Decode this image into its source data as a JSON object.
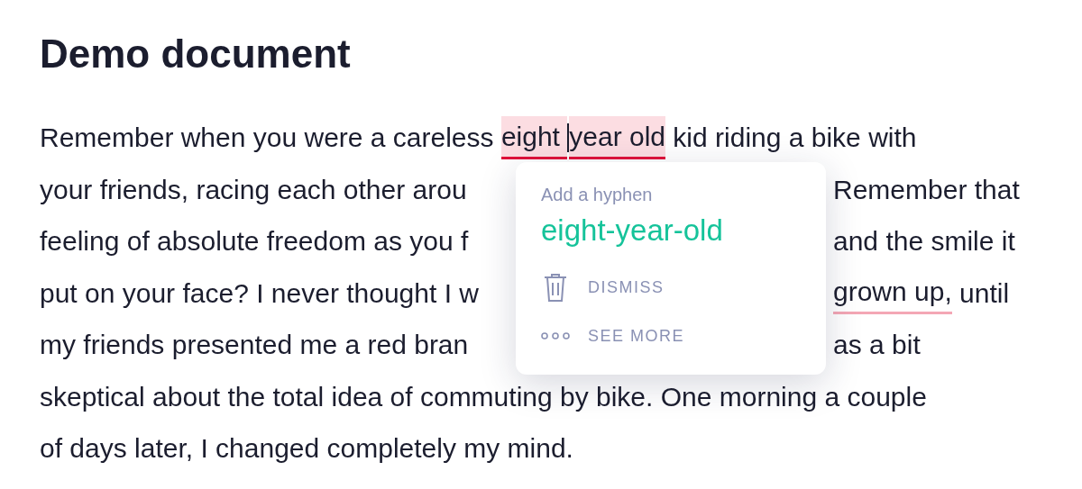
{
  "document": {
    "title": "Demo document"
  },
  "lines": [
    {
      "left": [
        {
          "kind": "plain",
          "text": "Remember when you were a careless "
        },
        {
          "kind": "error",
          "text": "eight "
        },
        {
          "kind": "cursor"
        },
        {
          "kind": "error",
          "text": "year old"
        },
        {
          "kind": "plain",
          "text": " kid riding a bike with"
        }
      ]
    },
    {
      "left": [
        {
          "kind": "plain",
          "text": "your friends, racing each other arou"
        }
      ],
      "right": [
        {
          "kind": "plain",
          "text": "Remember that"
        }
      ]
    },
    {
      "left": [
        {
          "kind": "plain",
          "text": "feeling of absolute freedom as you f"
        }
      ],
      "right": [
        {
          "kind": "plain",
          "text": "and the smile it"
        }
      ]
    },
    {
      "left": [
        {
          "kind": "plain",
          "text": "put on your face? I never thought I w"
        }
      ],
      "right": [
        {
          "kind": "warning",
          "text": "grown up,"
        },
        {
          "kind": "plain",
          "text": " until"
        }
      ]
    },
    {
      "left": [
        {
          "kind": "plain",
          "text": "my friends presented me a red bran"
        }
      ],
      "right": [
        {
          "kind": "plain",
          "text": "as a bit"
        }
      ]
    },
    {
      "left": [
        {
          "kind": "plain",
          "text": "skeptical about the total idea of commuting by bike. One morning a couple"
        }
      ]
    },
    {
      "left": [
        {
          "kind": "plain",
          "text": "of days later, I changed completely my mind."
        }
      ]
    }
  ],
  "suggestion_card": {
    "label": "Add a hyphen",
    "suggestion": "eight-year-old",
    "actions": [
      {
        "kind": "trash",
        "label": "DISMISS"
      },
      {
        "kind": "dots",
        "label": "SEE MORE"
      }
    ]
  }
}
